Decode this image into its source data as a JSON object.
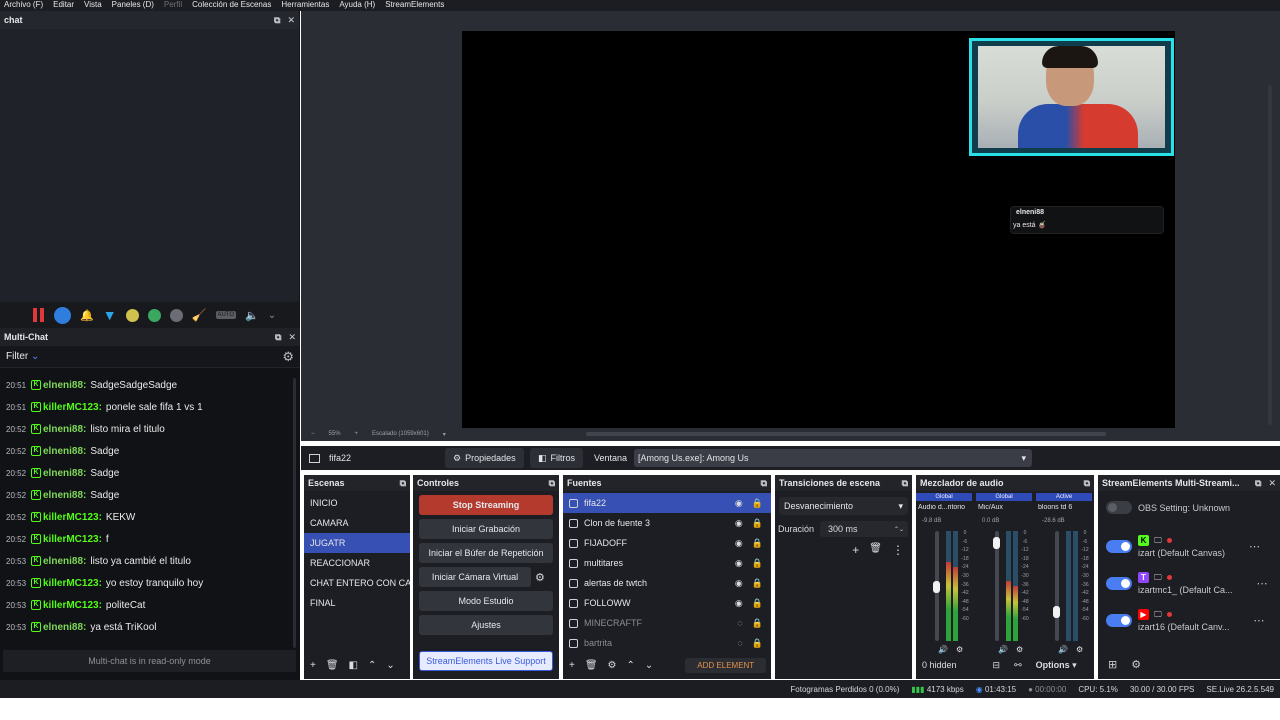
{
  "menu": [
    "Archivo (F)",
    "Editar",
    "Vista",
    "Paneles (D)",
    "Perfil",
    "Colección de Escenas",
    "Herramientas",
    "Ayuda (H)",
    "StreamElements"
  ],
  "chat_dock": {
    "title": "chat"
  },
  "multichat": {
    "title": "Multi-Chat",
    "filter_label": "Filter",
    "readonly": "Multi-chat is in read-only mode",
    "messages": [
      {
        "time": "20:51",
        "user": "elneni88:",
        "text": "SadgeSadgeSadge",
        "color": "#7ed957"
      },
      {
        "time": "20:51",
        "user": "killerMC123:",
        "text": "ponele sale fifa 1 vs 1",
        "color": "#53fc18"
      },
      {
        "time": "20:52",
        "user": "elneni88:",
        "text": "listo mira el titulo",
        "color": "#7ed957"
      },
      {
        "time": "20:52",
        "user": "elneni88:",
        "text": "Sadge",
        "color": "#7ed957"
      },
      {
        "time": "20:52",
        "user": "elneni88:",
        "text": "Sadge",
        "color": "#7ed957"
      },
      {
        "time": "20:52",
        "user": "elneni88:",
        "text": "Sadge",
        "color": "#7ed957"
      },
      {
        "time": "20:52",
        "user": "killerMC123:",
        "text": "KEKW",
        "color": "#53fc18"
      },
      {
        "time": "20:52",
        "user": "killerMC123:",
        "text": "f",
        "color": "#53fc18"
      },
      {
        "time": "20:53",
        "user": "elneni88:",
        "text": "listo ya cambié el titulo",
        "color": "#7ed957"
      },
      {
        "time": "20:53",
        "user": "killerMC123:",
        "text": "yo estoy tranquilo hoy",
        "color": "#53fc18"
      },
      {
        "time": "20:53",
        "user": "killerMC123:",
        "text": "politeCat",
        "color": "#53fc18"
      },
      {
        "time": "20:53",
        "user": "elneni88:",
        "text": "ya está TriKool",
        "color": "#7ed957"
      }
    ]
  },
  "preview": {
    "alert_user": "elneni88",
    "alert_msg": "ya está 🧉",
    "zoom": "55%",
    "scale_label": "Escalado (1059x601)"
  },
  "props_bar": {
    "source_name": "fifa22",
    "properties": "Propiedades",
    "filters": "Filtros",
    "window_label": "Ventana",
    "window_value": "[Among Us.exe]: Among Us"
  },
  "scenes": {
    "title": "Escenas",
    "items": [
      "INICIO",
      "CAMARA",
      "JUGATR",
      "REACCIONAR",
      "CHAT ENTERO CON CAM",
      "FINAL"
    ],
    "selected": 2
  },
  "controls": {
    "title": "Controles",
    "stop_streaming": "Stop Streaming",
    "start_recording": "Iniciar Grabación",
    "replay_buffer": "Iniciar el Búfer de Repetición",
    "virtual_cam": "Iniciar Cámara Virtual",
    "studio_mode": "Modo Estudio",
    "settings": "Ajustes",
    "se_support": "StreamElements Live Support",
    "stop_color": "#c0392b"
  },
  "sources": {
    "title": "Fuentes",
    "items": [
      "fifa22",
      "Clon de fuente 3",
      "FIJADOFF",
      "multitares",
      "alertas de twtch",
      "FOLLOWW",
      "MINECRAFTF",
      "bartrita"
    ],
    "add_element": "ADD ELEMENT"
  },
  "transitions": {
    "title": "Transiciones de escena",
    "selected": "Desvanecimiento",
    "duration_label": "Duración",
    "duration_value": "300 ms"
  },
  "mixer": {
    "title": "Mezclador de audio",
    "channels": [
      {
        "tag": "Global",
        "name": "Audio d...ritorio",
        "db": "-9.8 dB"
      },
      {
        "tag": "Global",
        "name": "Mic/Aux",
        "db": "0.0 dB"
      },
      {
        "tag": "Active",
        "name": "bloons td 6",
        "db": "-28.6 dB"
      }
    ],
    "scale": [
      "0",
      "-6",
      "-12",
      "-18",
      "-24",
      "-30",
      "-36",
      "-42",
      "-48",
      "-54",
      "-60"
    ],
    "hidden": "0 hidden",
    "options": "Options"
  },
  "se_multi": {
    "title": "StreamElements Multi-Streami...",
    "obs_setting": "OBS Setting: Unknown",
    "targets": [
      {
        "platform": "kick",
        "label": "izart (Default Canvas)",
        "color": "#53fc18"
      },
      {
        "platform": "twitch",
        "label": "izartmc1_ (Default Ca...",
        "color": "#9146ff"
      },
      {
        "platform": "youtube",
        "label": "izart16 (Default Canv...",
        "color": "#ff0000"
      }
    ]
  },
  "status_bar": {
    "dropped": "Fotogramas Perdidos 0 (0.0%)",
    "kbps": "4173 kbps",
    "live_time": "01:43:15",
    "rec_time": "00:00:00",
    "cpu": "CPU: 5.1%",
    "fps": "30.00 / 30.00 FPS",
    "version": "SE.Live 26.2.5.549"
  }
}
